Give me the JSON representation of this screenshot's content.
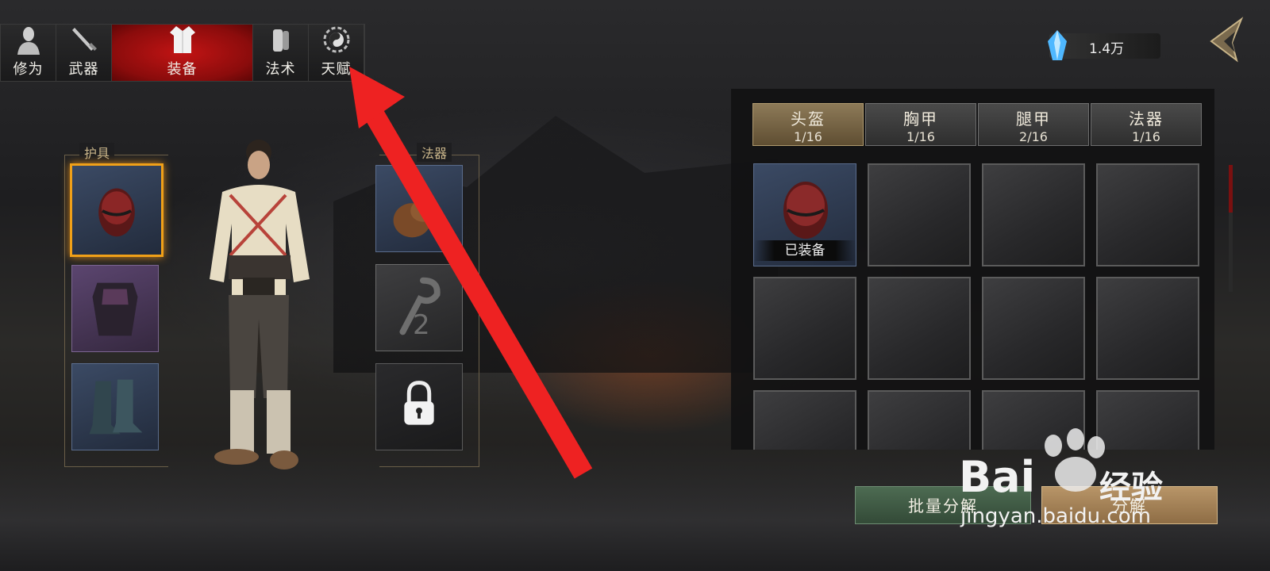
{
  "top_tabs": [
    {
      "label": "修为",
      "icon": "person-icon",
      "active": false
    },
    {
      "label": "武器",
      "icon": "sword-icon",
      "active": false
    },
    {
      "label": "装备",
      "icon": "robe-icon",
      "active": true
    },
    {
      "label": "法术",
      "icon": "scroll-icon",
      "active": false
    },
    {
      "label": "天赋",
      "icon": "bagua-icon",
      "active": false
    }
  ],
  "currency": {
    "value": "1.4万",
    "icon": "crystal-icon"
  },
  "equipment": {
    "armor_title": "护具",
    "artifact_title": "法器",
    "artifact_slot_count": "2"
  },
  "categories": [
    {
      "name": "头盔",
      "count": "1/16",
      "active": true
    },
    {
      "name": "胸甲",
      "count": "1/16",
      "active": false
    },
    {
      "name": "腿甲",
      "count": "2/16",
      "active": false
    },
    {
      "name": "法器",
      "count": "1/16",
      "active": false
    }
  ],
  "inventory": {
    "equipped_label": "已装备"
  },
  "buttons": {
    "batch_decompose": "批量分解",
    "decompose": "分解"
  },
  "watermark": {
    "brand": "Bai",
    "jingyan": "经验",
    "url": "jingyan.baidu.com"
  },
  "colors": {
    "active_tab": "#c21414",
    "category_active": "#8d7a58",
    "highlight": "#f0a018",
    "arrow": "#ee2222"
  }
}
